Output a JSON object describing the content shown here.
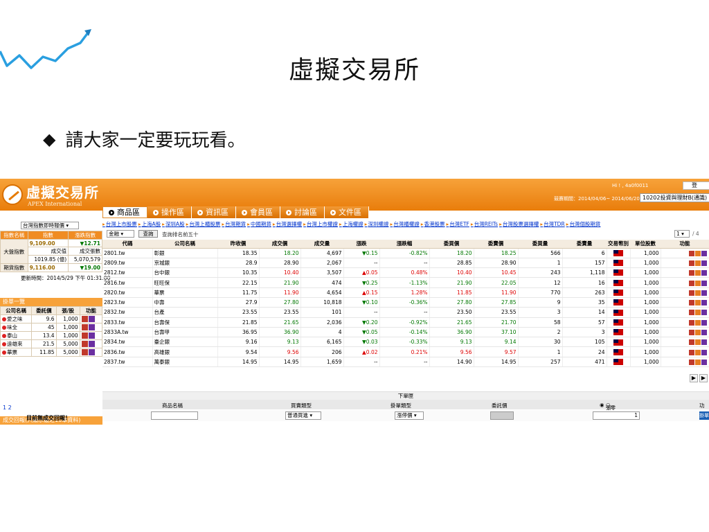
{
  "slide": {
    "title": "虛擬交易所",
    "bullet_symbol": "◆",
    "bullet": "請大家一定要玩玩看。"
  },
  "app": {
    "brand": "虛擬交易所",
    "brand_en": "APEX International",
    "greeting": "Hi ! , 4a0f0011",
    "logout": "登",
    "period_label": "競賽期間：",
    "period": "2014/04/06~ 2014/06/20",
    "contest": "10202投資與理財B(通識)",
    "colors": {
      "topbar": "#e97d0b",
      "up": "#dd0000",
      "down": "#007700",
      "link": "#0033cc"
    }
  },
  "nav": {
    "tabs": [
      "商品區",
      "操作區",
      "資訊區",
      "會員區",
      "討論區",
      "文件區"
    ],
    "active": 0
  },
  "subnav": [
    "台灣上市股票",
    "上海A股",
    "深圳A股",
    "台灣上櫃股票",
    "台灣期貨",
    "中國期貨",
    "台灣選擇權",
    "台灣上市權證",
    "上海權證",
    "深圳權證",
    "台灣櫃權證",
    "香港股票",
    "台灣ETF",
    "台灣REITs",
    "台灣股票選擇權",
    "台灣TDR",
    "台灣個股期貨"
  ],
  "index_panel": {
    "selector": "台灣指數即時報價",
    "headers": [
      "指數名稱",
      "指數",
      "漲跌指數"
    ],
    "taiex_label": "大盤指數",
    "taiex_value": "9,109.00",
    "taiex_change": "▼12.71",
    "turnover_label": "成交值",
    "turnover_value": "1019.85 (億)",
    "volume_label": "成交張數",
    "volume_value": "5,070,579",
    "futures_label": "期貨指數",
    "futures_value": "9,116.00",
    "futures_change": "▼19.00",
    "updated": "更新時間：2014/5/29 下午 01:31:00"
  },
  "watchlist": {
    "title": "掛單一覽",
    "headers": [
      "公司名稱",
      "委託價",
      "張/股",
      "功能"
    ],
    "rows": [
      {
        "name": "愛之味",
        "price": "9.6",
        "qty": "1,000"
      },
      {
        "name": "味全",
        "price": "45",
        "qty": "1,000"
      },
      {
        "name": "泰山",
        "price": "13.4",
        "qty": "1,000"
      },
      {
        "name": "遠雄來",
        "price": "21.5",
        "qty": "5,000"
      },
      {
        "name": "華票",
        "price": "11.85",
        "qty": "5,000"
      }
    ],
    "pages": "1 2"
  },
  "report": {
    "title": "成交回報(只顯示最近10筆資料)",
    "empty": "目前無成交回報！"
  },
  "main": {
    "filter": "金融",
    "query_button": "查詢",
    "query_note": "查詢排名前五十",
    "page_value": "1",
    "page_total": "/ 4",
    "headers": [
      "代碼",
      "公司名稱",
      "昨收價",
      "成交價",
      "成交量",
      "漲跌",
      "漲跌幅",
      "委買價",
      "委賣價",
      "委買量",
      "委賣量",
      "交易幣別",
      "單位股數",
      "功能"
    ],
    "rows": [
      {
        "code": "2801.tw",
        "name": "彰銀",
        "prev": "18.35",
        "price": "18.20",
        "vol": "4,697",
        "chg": "▼0.15",
        "pct": "-0.82%",
        "bid": "18.20",
        "ask": "18.25",
        "bidq": "566",
        "askq": "6",
        "unit": "1,000",
        "dir": "down"
      },
      {
        "code": "2809.tw",
        "name": "京城銀",
        "prev": "28.9",
        "price": "28.90",
        "vol": "2,067",
        "chg": "--",
        "pct": "--",
        "bid": "28.85",
        "ask": "28.90",
        "bidq": "1",
        "askq": "157",
        "unit": "1,000",
        "dir": "flat"
      },
      {
        "code": "2812.tw",
        "name": "台中銀",
        "prev": "10.35",
        "price": "10.40",
        "vol": "3,507",
        "chg": "▲0.05",
        "pct": "0.48%",
        "bid": "10.40",
        "ask": "10.45",
        "bidq": "243",
        "askq": "1,118",
        "unit": "1,000",
        "dir": "up"
      },
      {
        "code": "2816.tw",
        "name": "旺旺保",
        "prev": "22.15",
        "price": "21.90",
        "vol": "474",
        "chg": "▼0.25",
        "pct": "-1.13%",
        "bid": "21.90",
        "ask": "22.05",
        "bidq": "12",
        "askq": "16",
        "unit": "1,000",
        "dir": "down"
      },
      {
        "code": "2820.tw",
        "name": "華票",
        "prev": "11.75",
        "price": "11.90",
        "vol": "4,654",
        "chg": "▲0.15",
        "pct": "1.28%",
        "bid": "11.85",
        "ask": "11.90",
        "bidq": "770",
        "askq": "263",
        "unit": "1,000",
        "dir": "up"
      },
      {
        "code": "2823.tw",
        "name": "中壽",
        "prev": "27.9",
        "price": "27.80",
        "vol": "10,818",
        "chg": "▼0.10",
        "pct": "-0.36%",
        "bid": "27.80",
        "ask": "27.85",
        "bidq": "9",
        "askq": "35",
        "unit": "1,000",
        "dir": "down"
      },
      {
        "code": "2832.tw",
        "name": "台產",
        "prev": "23.55",
        "price": "23.55",
        "vol": "101",
        "chg": "--",
        "pct": "--",
        "bid": "23.50",
        "ask": "23.55",
        "bidq": "3",
        "askq": "14",
        "unit": "1,000",
        "dir": "flat"
      },
      {
        "code": "2833.tw",
        "name": "台壽保",
        "prev": "21.85",
        "price": "21.65",
        "vol": "2,036",
        "chg": "▼0.20",
        "pct": "-0.92%",
        "bid": "21.65",
        "ask": "21.70",
        "bidq": "58",
        "askq": "57",
        "unit": "1,000",
        "dir": "down"
      },
      {
        "code": "2833A.tw",
        "name": "台壽甲",
        "prev": "36.95",
        "price": "36.90",
        "vol": "4",
        "chg": "▼0.05",
        "pct": "-0.14%",
        "bid": "36.90",
        "ask": "37.10",
        "bidq": "2",
        "askq": "3",
        "unit": "1,000",
        "dir": "down"
      },
      {
        "code": "2834.tw",
        "name": "臺企銀",
        "prev": "9.16",
        "price": "9.13",
        "vol": "6,165",
        "chg": "▼0.03",
        "pct": "-0.33%",
        "bid": "9.13",
        "ask": "9.14",
        "bidq": "30",
        "askq": "105",
        "unit": "1,000",
        "dir": "down"
      },
      {
        "code": "2836.tw",
        "name": "高雄銀",
        "prev": "9.54",
        "price": "9.56",
        "vol": "206",
        "chg": "▲0.02",
        "pct": "0.21%",
        "bid": "9.56",
        "ask": "9.57",
        "bidq": "1",
        "askq": "24",
        "unit": "1,000",
        "dir": "up"
      },
      {
        "code": "2837.tw",
        "name": "萬泰銀",
        "prev": "14.95",
        "price": "14.95",
        "vol": "1,659",
        "chg": "--",
        "pct": "--",
        "bid": "14.90",
        "ask": "14.95",
        "bidq": "257",
        "askq": "471",
        "unit": "1,000",
        "dir": "flat"
      }
    ]
  },
  "order": {
    "title": "下單匣",
    "headers": [
      "商品名稱",
      "買賣類型",
      "掛單類型",
      "委託價",
      "功能"
    ],
    "trade_type": "普通買進",
    "order_type": "漲停價",
    "radio_lots": "張數",
    "radio_shares": "零股",
    "quantity": "1",
    "submit": "掛單"
  }
}
